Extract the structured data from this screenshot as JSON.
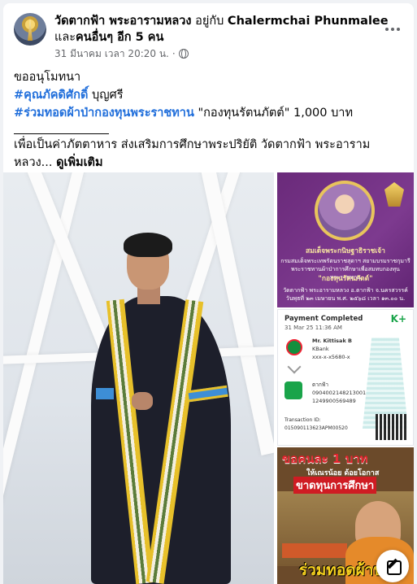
{
  "post": {
    "author": "วัดตากฟ้า พระอารามหลวง",
    "with_label": "อยู่กับ",
    "tagged": "Chalermchai Phunmalee",
    "and_label": "และ",
    "others": "คนอื่นๆ อีก 5 คน",
    "timestamp": "31 มีนาคม เวลา 20:20 น.",
    "separator": "·"
  },
  "content": {
    "line1": "ขออนุโมทนา",
    "hashtag1": "#คุณภัคดิศักดิ์",
    "line2_rest": " บุญศรี",
    "hashtag2": "#ร่วมทอดผ้าป่ากองทุนพระราชทาน",
    "line3_rest": " \"กองทุนรัตนภัตต์\" 1,000 บาท",
    "description": " เพื่อเป็นค่าภัตตาหาร ส่งเสริมการศึกษาพระปริยัติ วัดตากฟ้า พระอารามหลวง...",
    "see_more": "ดูเพิ่มเติม"
  },
  "thumb1": {
    "title": "สมเด็จพระกนิษฐาธิราชเจ้า",
    "line_a": "กรมสมเด็จพระเทพรัตนราชสุดาฯ สยามบรมราชกุมารี",
    "line_b": "พระราชทานผ้าป่าการศึกษาเพื่อสมทบกองทุนพระราชทาน",
    "fund": "\"กองทุนรัตนภัตต์\"",
    "line_c": "วัดตากฟ้า พระอารามหลวง อ.ตากฟ้า จ.นครสวรรค์",
    "line_d": "วันพุธที่ ๒๓ เมษายน พ.ศ. ๒๕๖๘ เวลา ๑๓.๐๐ น."
  },
  "thumb2": {
    "title": "Payment Completed",
    "date": "31 Mar 25  11:36 AM",
    "brand": "K+",
    "from_name": "Mr. Kittisak B",
    "from_bank": "KBank",
    "from_acct": "xxx-x-x5680-x",
    "to_name": "ตากฟ้า",
    "to_ref1": "0904002148213001",
    "to_ref2": "1249900569489",
    "tid_label": "Transaction ID:",
    "tid": "015090113623APM00520"
  },
  "thumb3": {
    "headline1": "ขอคนละ",
    "headline2": "1 บาท",
    "sub": "ให้เณรน้อย ด้อยโอกาส",
    "sub2": "ขาดทุนการศึกษา",
    "bottom": "ร่วมทอดผ้าป่า"
  }
}
